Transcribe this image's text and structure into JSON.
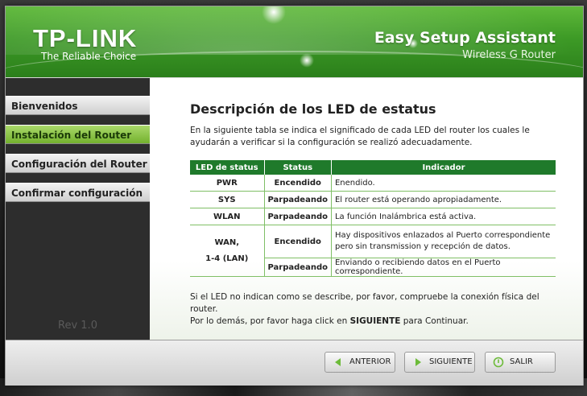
{
  "header": {
    "brand": "TP-LINK",
    "tagline": "The Reliable Choice",
    "title": "Easy Setup Assistant",
    "subtitle": "Wireless G Router"
  },
  "sidebar": {
    "items": [
      {
        "label": "Bienvenidos",
        "active": false
      },
      {
        "label": "Instalación del Router",
        "active": true
      },
      {
        "label": "Configuración del Router",
        "active": false
      },
      {
        "label": "Confirmar configuración",
        "active": false
      }
    ],
    "version": "Rev 1.0"
  },
  "content": {
    "title": "Descripción de los LED de estatus",
    "intro": "En la siguiente tabla se indica el significado de cada LED del router los cuales le ayudarán a verificar si la configuración se realizó adecuadamente.",
    "table": {
      "headers": [
        "LED de status",
        "Status",
        "Indicador"
      ],
      "rows": [
        {
          "led": "PWR",
          "status": "Encendido",
          "indicator": "Enendido."
        },
        {
          "led": "SYS",
          "status": "Parpadeando",
          "indicator": "El router está operando apropiadamente."
        },
        {
          "led": "WLAN",
          "status": "Parpadeando",
          "indicator": "La función Inalámbrica está activa."
        },
        {
          "led": "WAN,\n1-4 (LAN)",
          "status": "Encendido",
          "indicator": "Hay dispositivos enlazados al Puerto correspondiente pero sin transmission y recepción de datos."
        },
        {
          "led": "",
          "status": "Parpadeando",
          "indicator": "Enviando o recibiendo datos en el Puerto correspondiente."
        }
      ]
    },
    "footer_line1": "Si el LED no indican como se describe, por favor, compruebe la conexión física del router.",
    "footer_line2_prefix": "Por lo demás, por favor haga click en ",
    "footer_line2_bold": "SIGUIENTE",
    "footer_line2_suffix": " para Continuar."
  },
  "buttons": {
    "back": "ANTERIOR",
    "next": "SIGUIENTE",
    "exit": "SALIR"
  },
  "colors": {
    "brand_green": "#3d9a26",
    "table_header": "#1f7a2b",
    "active_nav": "#74b22e"
  }
}
